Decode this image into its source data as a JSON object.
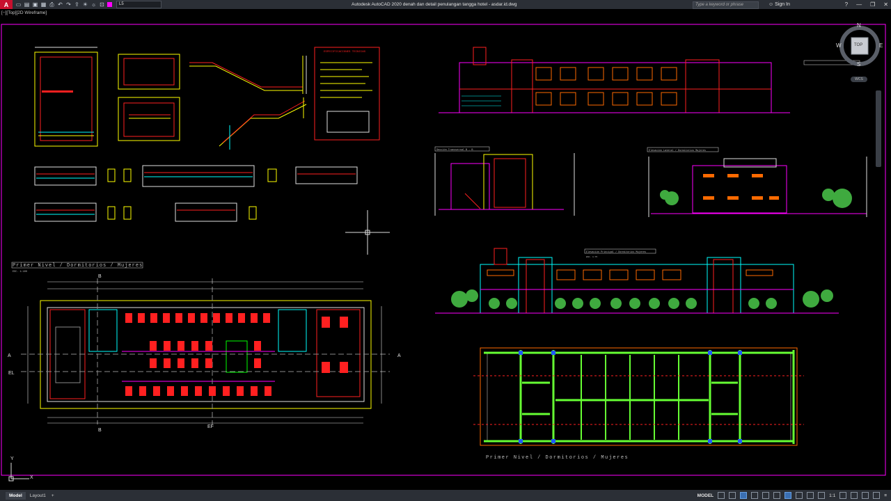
{
  "app": {
    "logo_letter": "A",
    "title": "Autodesk AutoCAD 2020   denah dan detail penulangan tangga hotel - asdar.id.dwg",
    "search_placeholder": "Type a keyword or phrase",
    "sign_in": "Sign In",
    "layer_name": "L5"
  },
  "viewport": {
    "label": "[−][Top][2D Wireframe]"
  },
  "viewcube": {
    "north": "N",
    "south": "S",
    "east": "E",
    "west": "W",
    "face": "TOP",
    "wcs": "WCS"
  },
  "drawing": {
    "plan_title_left": "Primer Nivel / Dormitorios / Mujeres",
    "plan_scale_left": "ESC. 1:100",
    "plan_title_bottom": "Primer Nivel / Dormitorios / Mujeres",
    "spec_title": "ESPECIFICACIONES TECNICAS",
    "elev_title_front": "Elevación Principal / Dormitorios Mujeres",
    "elev_scale_front": "ESC. 1:75",
    "section_title": "Sección Transversal  B - B",
    "elev_title_side": "Elevación Lateral / Dormitorios Mujeres",
    "axis_a": "A",
    "axis_b": "B",
    "axis_el": "EL",
    "axis_ef": "EF"
  },
  "ucs": {
    "x": "X",
    "y": "Y"
  },
  "statusbar": {
    "tab_model": "Model",
    "tab_layout": "Layout1",
    "tab_add": "+",
    "model_label": "MODEL",
    "scale": "1:1"
  },
  "colors": {
    "accent_magenta": "#ff00ff",
    "cad_red": "#ff2020",
    "cad_yellow": "#ffff00",
    "cad_green": "#66ff33",
    "cad_cyan": "#00ffff",
    "cad_white": "#e0e0e0"
  }
}
